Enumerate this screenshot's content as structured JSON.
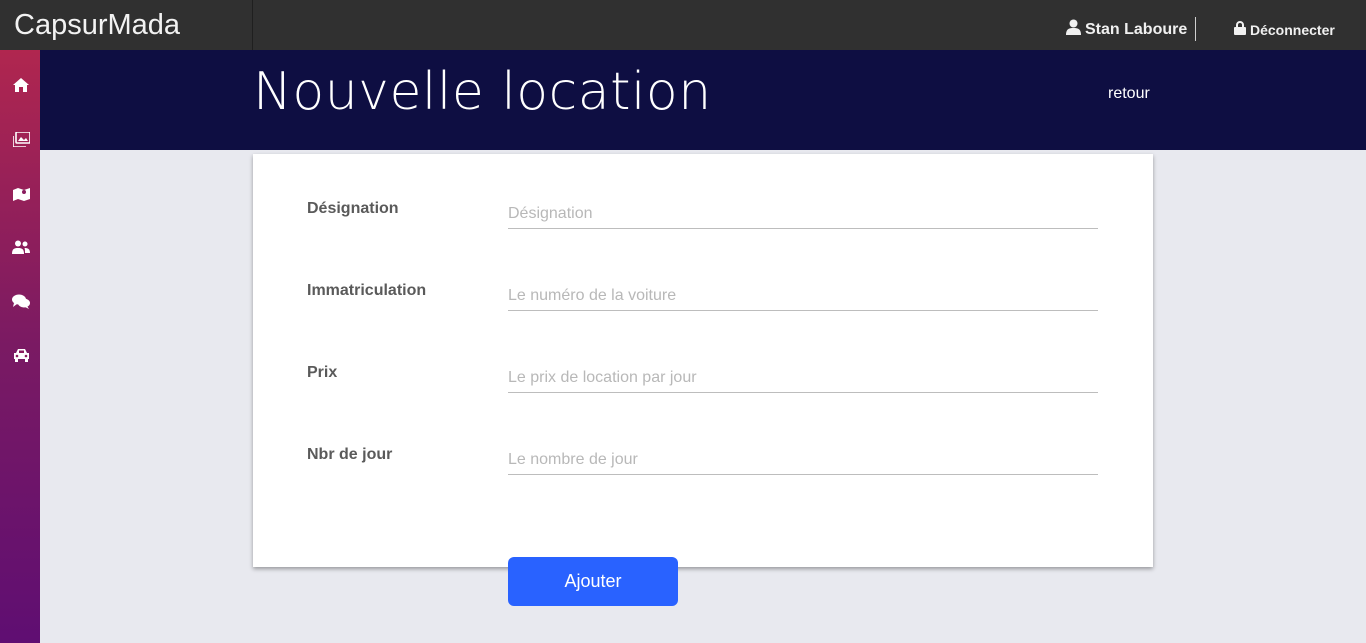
{
  "app": {
    "brand": "CapsurMada"
  },
  "topbar": {
    "user_icon": "user-icon",
    "user_name": "Stan Laboure",
    "logout_icon": "lock-icon",
    "logout_label": "Déconnecter"
  },
  "sidebar": {
    "items": [
      {
        "icon": "home-icon"
      },
      {
        "icon": "images-icon"
      },
      {
        "icon": "map-icon"
      },
      {
        "icon": "users-icon"
      },
      {
        "icon": "comments-icon"
      },
      {
        "icon": "car-icon"
      }
    ]
  },
  "header": {
    "title": "Nouvelle location",
    "back_label": "retour"
  },
  "form": {
    "fields": [
      {
        "label": "Désignation",
        "placeholder": "Désignation",
        "value": ""
      },
      {
        "label": "Immatriculation",
        "placeholder": "Le numéro de la voiture",
        "value": ""
      },
      {
        "label": "Prix",
        "placeholder": "Le prix de location par jour",
        "value": ""
      },
      {
        "label": "Nbr de jour",
        "placeholder": "Le nombre de jour",
        "value": ""
      }
    ],
    "submit_label": "Ajouter"
  },
  "colors": {
    "topbar": "#303030",
    "header": "#0e0e42",
    "sidebar_top": "#b0264f",
    "sidebar_bottom": "#5f0e72",
    "accent": "#2962ff"
  }
}
